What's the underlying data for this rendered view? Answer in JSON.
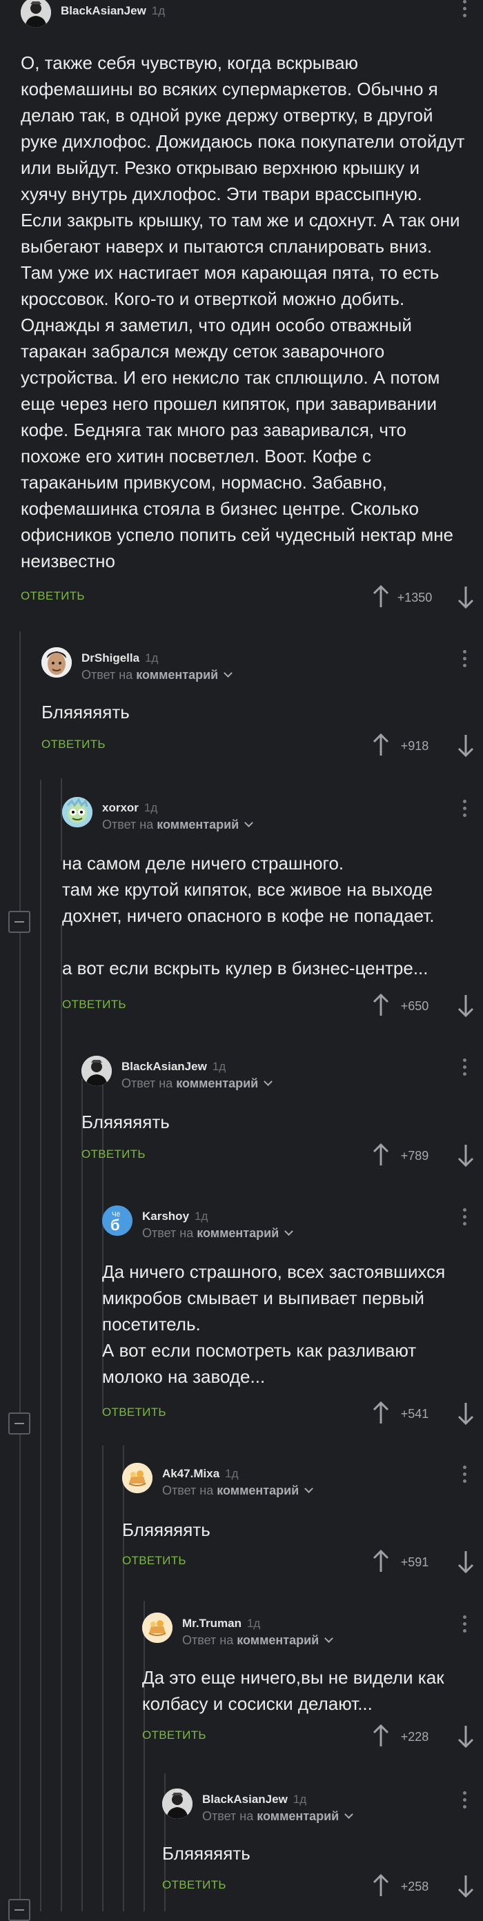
{
  "ui": {
    "reply_label": "ОТВЕТИТЬ",
    "reply_to_prefix": "Ответ на",
    "reply_to_target": "комментарий"
  },
  "comments": [
    {
      "author": "BlackAsianJew",
      "time": "1д",
      "avatar": "user-bw",
      "text": "О, также себя чувствую, когда вскрываю кофемашины во всяких супермаркетов. Обычно я делаю так, в одной руке держу отвертку, в другой руке дихлофос. Дожидаюсь пока покупатели отойдут или выйдут. Резко открываю верхнюю крышку и хуячу внутрь дихлофос. Эти твари врассыпную. Если закрыть крышку, то там же и сдохнут. А так они выбегают наверх и пытаются спланировать вниз. Там уже их настигает моя карающая пята, то есть кроссовок. Кого-то и отверткой можно добить. Однажды я заметил, что один особо отважный таракан забрался между сеток заварочного устройства. И его некисло так сплющило. А потом еще через него прошел кипяток, при заваривании кофе. Бедняга так много раз заваривался, что похоже его хитин посветлел. Воот. Кофе с тараканьим привкусом, нормасно. Забавно, кофемашинка стояла в бизнес центре. Сколько офисников успело попить сей чудесный нектар мне неизвестно",
      "score": "+1350"
    },
    {
      "author": "DrShigella",
      "time": "1д",
      "avatar": "face",
      "text": "Бляяяяять",
      "score": "+918"
    },
    {
      "author": "xorxor",
      "time": "1д",
      "avatar": "cartoon",
      "text": "на самом деле ничего страшного.\nтам же крутой кипяток, все живое на выходе дохнет, ничего опасного в кофе не попадает.\n\nа вот если вскрыть кулер в бизнес-центре...",
      "score": "+650"
    },
    {
      "author": "BlackAsianJew",
      "time": "1д",
      "avatar": "user-bw",
      "text": "Бляяяяять",
      "score": "+789"
    },
    {
      "author": "Karshoy",
      "time": "1д",
      "avatar": "badge",
      "avatar_text_top": "Чё",
      "avatar_text_mid": "б",
      "text": "Да ничего страшного, всех застоявшихся микробов смывает и выпивает первый посетитель.\nА вот если посмотреть как разливают молоко на заводе...",
      "score": "+541"
    },
    {
      "author": "Ak47.Mixa",
      "time": "1д",
      "avatar": "food",
      "text": "Бляяяяять",
      "score": "+591"
    },
    {
      "author": "Mr.Truman",
      "time": "1д",
      "avatar": "food",
      "text": "Да это еще ничего,вы не видели как колбасу и сосиски делают...",
      "score": "+228"
    },
    {
      "author": "BlackAsianJew",
      "time": "1д",
      "avatar": "user-bw",
      "text": "Бляяяяять",
      "score": "+258"
    }
  ],
  "colors": {
    "background": "#1e1f22",
    "accent": "#7cba3e",
    "thread": "#3a3c41",
    "text": "#e6e6e6"
  }
}
